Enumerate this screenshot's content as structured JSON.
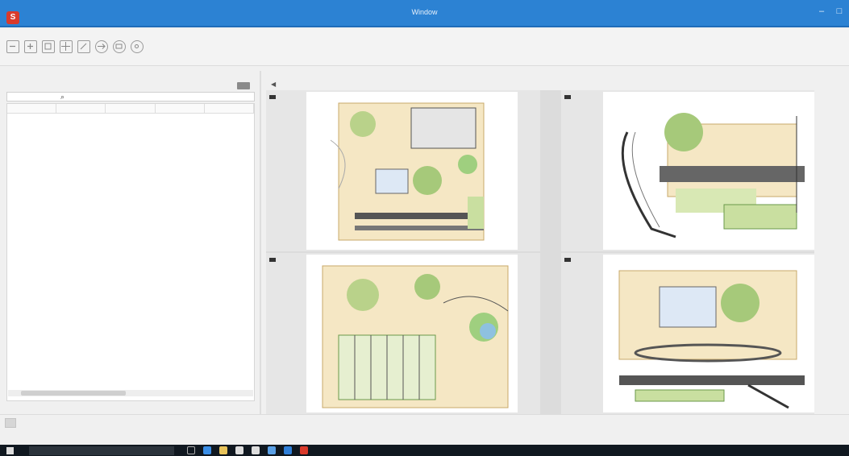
{
  "window": {
    "title": "Window",
    "min": "–",
    "max": "□",
    "close": "✕"
  },
  "toolbar": {
    "icons": [
      "new-icon",
      "import-icon",
      "save-icon",
      "grid-icon",
      "rename-icon",
      "swap-icon",
      "print-icon",
      "help-icon"
    ]
  },
  "left_pane": {
    "label": "",
    "path": "",
    "columns": [
      "",
      "",
      "",
      "",
      ""
    ],
    "status_left": "",
    "status_right": ""
  },
  "right_pane": {
    "label": "",
    "path": ""
  },
  "statusbar": {
    "button": "",
    "right": ""
  },
  "taskbar": {
    "search_placeholder": "",
    "tray": ""
  },
  "colors": {
    "title_bar": "#2c82d3",
    "taskbar": "#101820",
    "app_icon": "#d93a2b"
  }
}
